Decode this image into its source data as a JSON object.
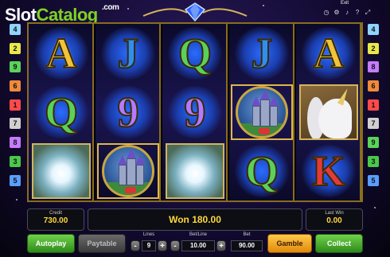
{
  "watermark": {
    "slot": "Slot",
    "catalog": "Catalog",
    "com": ".com"
  },
  "top": {
    "exit_label": "Exit",
    "icons": [
      "clock-icon",
      "settings-icon",
      "sound-icon",
      "help-icon",
      "fullscreen-icon"
    ]
  },
  "markers": {
    "left": [
      {
        "n": "4",
        "color": "#8fd3ff"
      },
      {
        "n": "2",
        "color": "#e8e84a"
      },
      {
        "n": "9",
        "color": "#5ad35a"
      },
      {
        "n": "6",
        "color": "#f08a3a"
      },
      {
        "n": "1",
        "color": "#ff4a4a"
      },
      {
        "n": "7",
        "color": "#d0d0d0"
      },
      {
        "n": "8",
        "color": "#c57bff"
      },
      {
        "n": "3",
        "color": "#4ac84a"
      },
      {
        "n": "5",
        "color": "#5a9dff"
      }
    ],
    "right": [
      {
        "n": "4",
        "color": "#8fd3ff"
      },
      {
        "n": "2",
        "color": "#e8e84a"
      },
      {
        "n": "8",
        "color": "#c57bff"
      },
      {
        "n": "6",
        "color": "#f08a3a"
      },
      {
        "n": "1",
        "color": "#ff4a4a"
      },
      {
        "n": "7",
        "color": "#d0d0d0"
      },
      {
        "n": "9",
        "color": "#5ad35a"
      },
      {
        "n": "3",
        "color": "#4ac84a"
      },
      {
        "n": "5",
        "color": "#5a9dff"
      }
    ]
  },
  "reels": [
    [
      "A",
      "Q",
      "mist"
    ],
    [
      "J",
      "9",
      "castle"
    ],
    [
      "Q",
      "9",
      "mist"
    ],
    [
      "J",
      "castle",
      "Q"
    ],
    [
      "A",
      "unicorn",
      "K"
    ]
  ],
  "symbol_text": {
    "A": "A",
    "J": "J",
    "Q": "Q",
    "9": "9",
    "K": "K"
  },
  "panel": {
    "credit_label": "Credit",
    "credit_value": "730.00",
    "won_text": "Won 180.00",
    "last_win_label": "Last Win",
    "last_win_value": "0.00",
    "autoplay": "Autoplay",
    "paytable": "Paytable",
    "lines_label": "Lines",
    "lines_value": "9",
    "betline_label": "Bet/Line",
    "betline_value": "10.00",
    "bet_label": "Bet",
    "bet_value": "90.00",
    "minus": "-",
    "plus": "+",
    "gamble": "Gamble",
    "collect": "Collect"
  },
  "colors": {
    "accent_gold": "#d4b45a",
    "button_green": "#3fa82a",
    "button_orange": "#f0a020",
    "win_text": "#ffd83a"
  }
}
